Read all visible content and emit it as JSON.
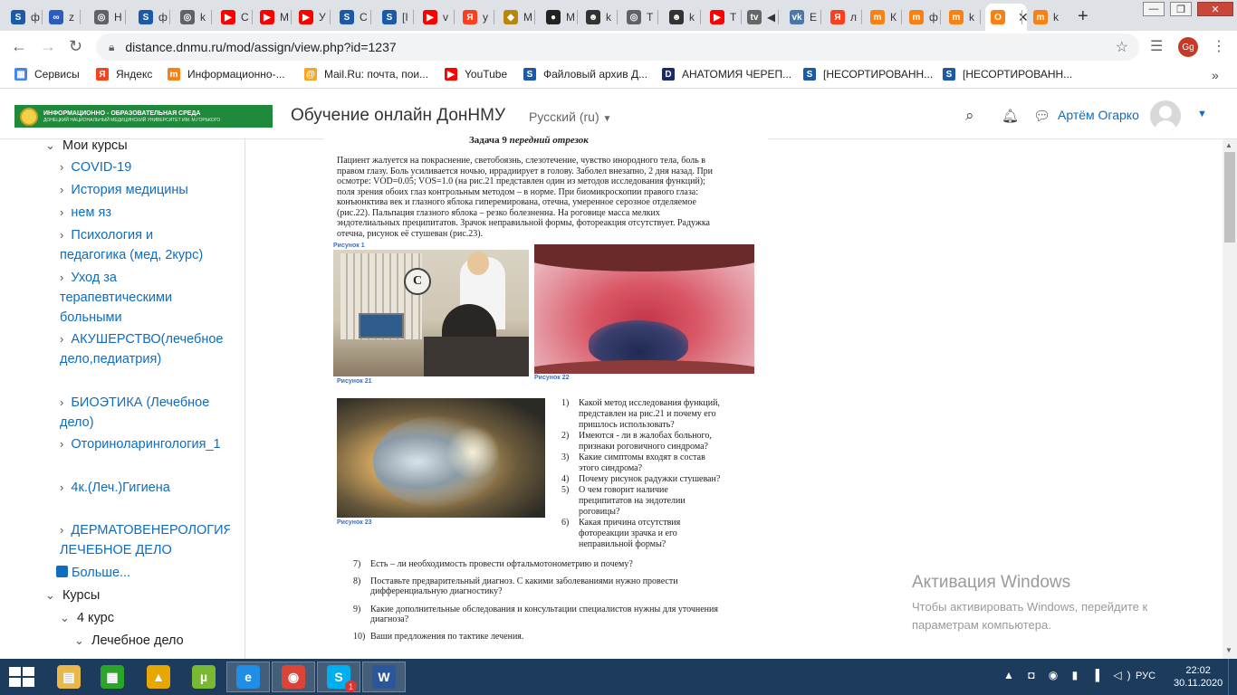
{
  "browser": {
    "tabs": [
      {
        "short": "S",
        "label": "ф",
        "color": "#1a5aa8"
      },
      {
        "short": "∞",
        "label": "z",
        "color": "#2b5cc4"
      },
      {
        "short": "◎",
        "label": "Н",
        "color": "#5f6368"
      },
      {
        "short": "S",
        "label": "ф",
        "color": "#1a5aa8"
      },
      {
        "short": "◎",
        "label": "k",
        "color": "#5f6368"
      },
      {
        "short": "▶",
        "label": "С",
        "color": "#ff0000"
      },
      {
        "short": "▶",
        "label": "M",
        "color": "#ff0000"
      },
      {
        "short": "▶",
        "label": "У",
        "color": "#ff0000"
      },
      {
        "short": "S",
        "label": "С",
        "color": "#1a5aa8"
      },
      {
        "short": "S",
        "label": "[І",
        "color": "#1a5aa8"
      },
      {
        "short": "▶",
        "label": "v",
        "color": "#ff0000"
      },
      {
        "short": "Я",
        "label": "у",
        "color": "#fc3f1d"
      },
      {
        "short": "◆",
        "label": "М",
        "color": "#b8860b"
      },
      {
        "short": "●",
        "label": "М",
        "color": "#222222"
      },
      {
        "short": "☻",
        "label": "k",
        "color": "#333333"
      },
      {
        "short": "◎",
        "label": "Т",
        "color": "#5f6368"
      },
      {
        "short": "☻",
        "label": "k",
        "color": "#333333"
      },
      {
        "short": "▶",
        "label": "Т",
        "color": "#ff0000"
      },
      {
        "short": "tv",
        "label": "◀",
        "color": "#666666"
      },
      {
        "short": "vk",
        "label": "Е",
        "color": "#4a76a8"
      },
      {
        "short": "Я",
        "label": "л",
        "color": "#fc3f1d"
      },
      {
        "short": "m",
        "label": "К",
        "color": "#f98012"
      },
      {
        "short": "m",
        "label": "ф",
        "color": "#f98012"
      },
      {
        "short": "m",
        "label": "k",
        "color": "#f98012"
      },
      {
        "short": "О",
        "label": "О",
        "color": "#f98012"
      },
      {
        "short": "m",
        "label": "k",
        "color": "#f98012"
      }
    ],
    "active_tab_close": "✕",
    "new_tab": "+",
    "url": "distance.dnmu.ru/mod/assign/view.php?id=1237",
    "profile_initials": "Gg",
    "bookmarks": [
      {
        "label": "Сервисы",
        "icon": "apps-grid-icon"
      },
      {
        "label": "Яндекс",
        "icon": "yandex-icon"
      },
      {
        "label": "Информационно-...",
        "icon": "moodle-icon"
      },
      {
        "label": "Mail.Ru: почта, пои...",
        "icon": "mail-ru-icon"
      },
      {
        "label": "YouTube",
        "icon": "youtube-icon"
      },
      {
        "label": "Файловый архив Д...",
        "icon": "studfile-icon"
      },
      {
        "label": "АНАТОМИЯ ЧЕРЕП...",
        "icon": "d-icon"
      },
      {
        "label": "[НЕСОРТИРОВАНН...",
        "icon": "studfile-icon"
      },
      {
        "label": "[НЕСОРТИРОВАНН...",
        "icon": "studfile-icon"
      }
    ],
    "bookmarks_more": "»"
  },
  "header": {
    "logo_line1": "ИНФОРМАЦИОННО - ОБРАЗОВАТЕЛЬНАЯ СРЕДА",
    "logo_line2": "ДОНЕЦКИЙ НАЦИОНАЛЬНЫЙ МЕДИЦИНСКИЙ УНИВЕРСИТЕТ ИМ. М.ГОРЬКОГО",
    "site_name": "Обучение онлайн ДонНМУ",
    "language": "Русский (ru)",
    "user_name": "Артём Огарко"
  },
  "sidebar": {
    "my_courses": "Мои курсы",
    "courses": [
      "COVID-19",
      "История медицины",
      "нем яз",
      "Психология и педагогика (мед, 2курс)",
      "Уход за терапевтическими больными",
      "АКУШЕРСТВО(лечебное дело,педиатрия)",
      "БИОЭТИКА (Лечебное дело)",
      "Оториноларингология_1",
      "4к.(Леч.)Гигиена",
      "ДЕРМАТОВЕНЕРОЛОГИЯ ЛЕЧЕБНОЕ ДЕЛО"
    ],
    "more": "Больше...",
    "courses_section": "Курсы",
    "year": "4 курс",
    "faculty": "Лечебное дело"
  },
  "document": {
    "title_prefix": "Задача 9",
    "title_suffix": "передний отрезок",
    "paragraph": [
      "Пациент жалуется на покраснение, светобоязнь, слезотечение, чувство инородного тела, боль в",
      "правом глазу. Боль усиливается ночью, иррадиирует в голову. Заболел внезапно, 2 дня назад. При",
      "осмотре: VOD=0.05; VOS=1.0 (на рис.21 представлен один из методов исследования функций);",
      "поля зрения обоих глаз контрольным методом – в норме. При биомикроскопии правого глаза:",
      "конъюнктива век и глазного яблока гиперемирована, отечна, умеренное серозное отделяемое",
      "(рис.22). Пальпация глазного яблока – резко болезненна. На роговице масса мелких",
      "эндотелиальных преципитатов. Зрачок неправильной формы, фотореакция отсутствует. Радужка",
      "отечна, рисунок её стушеван (рис.23)."
    ],
    "fig_top_caption": "Рисунок 1",
    "fig21": "Рисунок 21",
    "fig22": "Рисунок 22",
    "fig23": "Рисунок 23",
    "questions_right": [
      {
        "n": "1)",
        "lines": [
          "Какой метод исследования функций,",
          "представлен на рис.21 и почему его",
          "пришлось использовать?"
        ]
      },
      {
        "n": "2)",
        "lines": [
          "Имеются - ли в жалобах больного,",
          "признаки роговичного синдрома?"
        ]
      },
      {
        "n": "3)",
        "lines": [
          "Какие симптомы входят в состав",
          "этого синдрома?"
        ]
      },
      {
        "n": "4)",
        "lines": [
          "Почему рисунок радужки стушеван?"
        ]
      },
      {
        "n": "5)",
        "lines": [
          "О чем говорит наличие",
          "преципитатов на эндотелии",
          "роговицы?"
        ]
      },
      {
        "n": "6)",
        "lines": [
          "Какая причина отсутствия",
          "фотореакции зрачка и его",
          "неправильной формы?"
        ]
      }
    ],
    "questions_bottom": [
      {
        "n": "7)",
        "lines": [
          "Есть – ли необходимость провести офтальмотонометрию и почему?"
        ]
      },
      {
        "n": "8)",
        "lines": [
          "Поставьте предварительный диагноз. С какими заболеваниями нужно провести",
          "дифференциальную диагностику?"
        ]
      },
      {
        "n": "9)",
        "lines": [
          "Какие дополнительные обследования и консультации специалистов нужны для уточнения",
          "диагноза?"
        ]
      },
      {
        "n": "10)",
        "lines": [
          "Ваши предложения по тактике лечения."
        ]
      }
    ]
  },
  "watermark": {
    "title": "Активация Windows",
    "line1": "Чтобы активировать Windows, перейдите к",
    "line2": "параметрам компьютера."
  },
  "taskbar": {
    "language": "РУС",
    "time": "22:02",
    "date": "30.11.2020",
    "apps": [
      {
        "name": "file-explorer",
        "color": "#e8b84a",
        "glyph": "▤"
      },
      {
        "name": "store",
        "color": "#2aa52a",
        "glyph": "▦"
      },
      {
        "name": "archicad",
        "color": "#e6a700",
        "glyph": "▲"
      },
      {
        "name": "utorrent",
        "color": "#78b833",
        "glyph": "µ"
      },
      {
        "name": "internet-explorer",
        "color": "#1e8ee6",
        "glyph": "e"
      },
      {
        "name": "chrome",
        "color": "#db4437",
        "glyph": "◉"
      },
      {
        "name": "skype",
        "color": "#00aff0",
        "glyph": "S"
      },
      {
        "name": "word",
        "color": "#2b579a",
        "glyph": "W"
      }
    ],
    "skype_badge": "1"
  }
}
